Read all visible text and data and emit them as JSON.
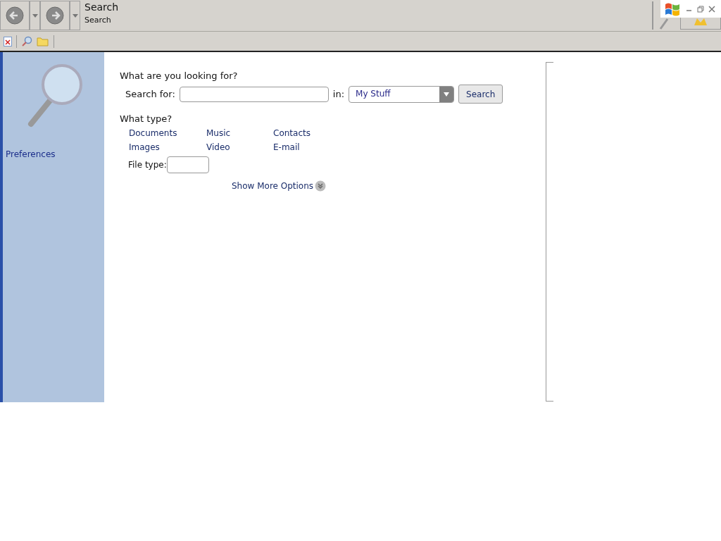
{
  "header": {
    "title": "Search",
    "subtitle": "Search"
  },
  "sidebar": {
    "link": "Preferences"
  },
  "form": {
    "heading": "What are you looking for?",
    "search_label": "Search for:",
    "in_label": "in:",
    "scope": "My Stuff",
    "button": "Search"
  },
  "types": {
    "heading": "What type?",
    "items": [
      "Documents",
      "Music",
      "Contacts",
      "Images",
      "Video",
      "E-mail"
    ],
    "file_type_label": "File type:"
  },
  "more_options": "Show More Options"
}
